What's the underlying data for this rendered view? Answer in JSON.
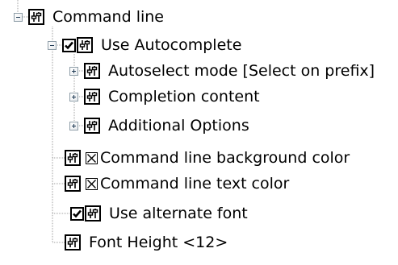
{
  "tree": {
    "nodes": [
      {
        "label": "Command line",
        "expander": "minus",
        "checkbox": false,
        "swatch": false
      },
      {
        "label": "Use Autocomplete",
        "expander": "minus",
        "checkbox": true,
        "swatch": false
      },
      {
        "label": "Autoselect mode [Select on prefix]",
        "expander": "plus",
        "checkbox": false,
        "swatch": false
      },
      {
        "label": "Completion content",
        "expander": "plus",
        "checkbox": false,
        "swatch": false
      },
      {
        "label": "Additional Options",
        "expander": "plus",
        "checkbox": false,
        "swatch": false
      },
      {
        "label": "Command line background color",
        "expander": "none",
        "checkbox": false,
        "swatch": true
      },
      {
        "label": "Command line text color",
        "expander": "none",
        "checkbox": false,
        "swatch": true
      },
      {
        "label": "Use alternate font",
        "expander": "none",
        "checkbox": true,
        "swatch": false
      },
      {
        "label": "Font Height <12>",
        "expander": "none",
        "checkbox": false,
        "swatch": false
      }
    ]
  },
  "icons": {
    "expander_collapsed": "plus-box-icon",
    "expander_expanded": "minus-box-icon",
    "property": "property-sliders-icon",
    "checkbox_checked": "checkmark-icon",
    "color_swatch": "color-swatch-x-icon"
  },
  "colors": {
    "background": "#ffffff",
    "text": "#000000",
    "connector": "#a0a0a0",
    "expander_border": "#8f9ea8"
  }
}
